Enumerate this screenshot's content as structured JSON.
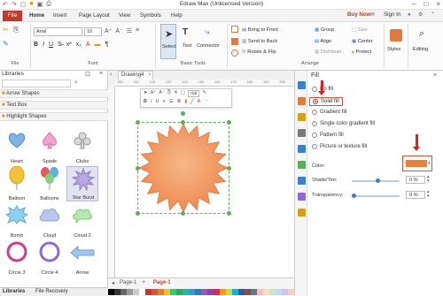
{
  "titlebar": {
    "title": "Edraw Max (Unlicensed Version)"
  },
  "menu": {
    "file": "File",
    "tabs": [
      "Home",
      "Insert",
      "Page Layout",
      "View",
      "Symbols",
      "Help"
    ],
    "buy_now": "Buy Now",
    "sign_in": "Sign In"
  },
  "ribbon": {
    "font_name": "Arial",
    "font_size": "10",
    "groups": {
      "file": "File",
      "font": "Font",
      "basic_tools": "Basic Tools",
      "arrange": "Arrange"
    },
    "tools": {
      "select": "Select",
      "text": "Text",
      "connector": "Connector"
    },
    "arrange": {
      "bring_to_front": "Bring to Front",
      "send_to_back": "Send to Back",
      "rotate_flip": "Rotate & Flip",
      "group": "Group",
      "align": "Align",
      "distribute": "Distribute",
      "size": "Size",
      "center": "Center",
      "protect": "Protect"
    },
    "styles": "Styles",
    "editing": "Editing"
  },
  "libraries": {
    "title": "Libraries",
    "sections": [
      "Arrow Shapes",
      "Text Box",
      "Highlight Shapes"
    ],
    "shapes": [
      "Heart",
      "Spade",
      "Clubs",
      "Balloon",
      "Balloons",
      "Star Burst",
      "Bomb",
      "Cloud",
      "Cloud 2",
      "Circle 3",
      "Circle 4",
      "Arrow"
    ],
    "bottom_tabs": [
      "Libraries",
      "File Recovery"
    ]
  },
  "canvas": {
    "doc_tab": "Drawing4",
    "ruler_marks": [
      "100",
      "110",
      "120",
      "130",
      "140",
      "150",
      "160",
      "170",
      "180",
      "190",
      "200"
    ],
    "mini_toolbar_font": "rial",
    "page_tabs": [
      "Page-1",
      "Page-1"
    ]
  },
  "fill_panel": {
    "title": "Fill",
    "options": [
      "No fill",
      "Solid fill",
      "Gradient fill",
      "Single color gradient fill",
      "Pattern fill",
      "Picture or texture fill"
    ],
    "selected": "Solid fill",
    "color_label": "Color:",
    "color_value": "#e8803a",
    "shade_label": "Shade/Tint:",
    "shade_value": "0 %",
    "transparency_label": "Transparency:",
    "transparency_value": "0 %"
  },
  "colors": {
    "accent": "#c0392b",
    "shape_fill": "#f0a070",
    "shape_edge": "#e07a40",
    "highlight": "#e74c3c"
  }
}
